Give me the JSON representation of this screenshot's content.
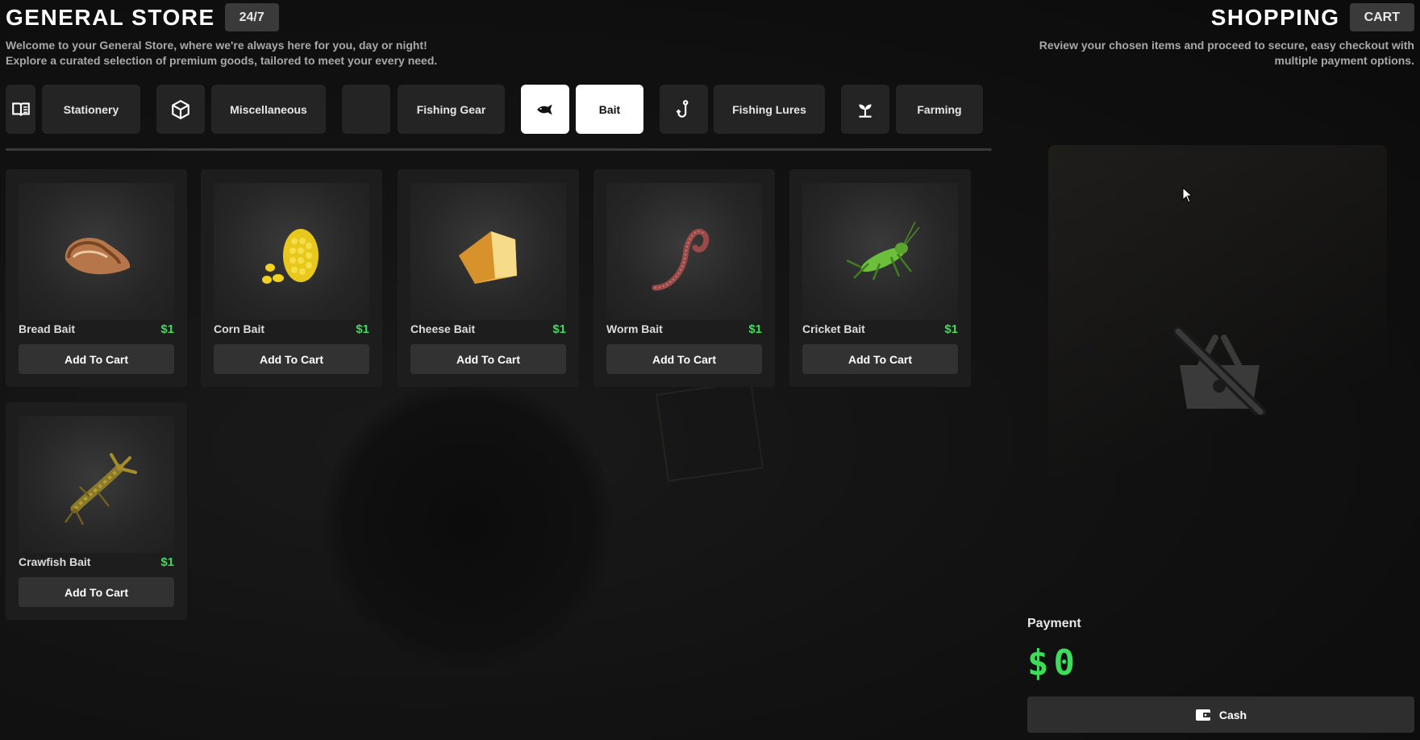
{
  "header": {
    "title": "GENERAL STORE",
    "badge": "24/7",
    "description_line1": "Welcome to your General Store, where we're always here for you, day or night!",
    "description_line2": "Explore a curated selection of premium goods, tailored to meet your every need."
  },
  "cart_header": {
    "title": "SHOPPING",
    "badge": "CART",
    "description_line1": "Review your chosen items and proceed to secure, easy checkout with",
    "description_line2": "multiple payment options."
  },
  "categories": [
    {
      "label": "Stationery",
      "icon": "book-icon",
      "active": false
    },
    {
      "label": "Miscellaneous",
      "icon": "box-icon",
      "active": false
    },
    {
      "label": "Fishing Gear",
      "icon": "blank",
      "active": false
    },
    {
      "label": "Bait",
      "icon": "fish-icon",
      "active": true
    },
    {
      "label": "Fishing Lures",
      "icon": "hook-icon",
      "active": false
    },
    {
      "label": "Farming",
      "icon": "sprout-icon",
      "active": false
    }
  ],
  "products": [
    {
      "name": "Bread Bait",
      "price": "$1",
      "button": "Add To Cart",
      "image": "bread"
    },
    {
      "name": "Corn Bait",
      "price": "$1",
      "button": "Add To Cart",
      "image": "corn"
    },
    {
      "name": "Cheese Bait",
      "price": "$1",
      "button": "Add To Cart",
      "image": "cheese"
    },
    {
      "name": "Worm Bait",
      "price": "$1",
      "button": "Add To Cart",
      "image": "worm"
    },
    {
      "name": "Cricket Bait",
      "price": "$1",
      "button": "Add To Cart",
      "image": "cricket"
    },
    {
      "name": "Crawfish Bait",
      "price": "$1",
      "button": "Add To Cart",
      "image": "crawfish"
    }
  ],
  "payment": {
    "label": "Payment",
    "amount": "$0",
    "cash_button": "Cash"
  },
  "colors": {
    "accent_green": "#3ddc5a",
    "active_tab": "#ffffff",
    "panel": "#1d1d1d"
  }
}
